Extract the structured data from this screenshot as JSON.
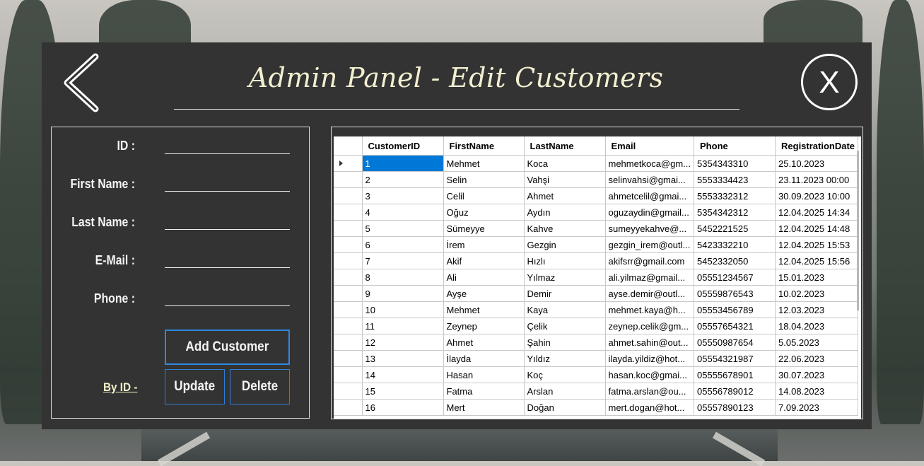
{
  "window": {
    "title": "Admin Panel - Edit Customers",
    "back_icon": "chevron-left-icon",
    "close_icon": "close-x-icon",
    "close_label": "X"
  },
  "form": {
    "id_label": "ID :",
    "first_name_label": "First Name :",
    "last_name_label": "Last Name :",
    "email_label": "E-Mail :",
    "phone_label": "Phone :",
    "id_value": "",
    "first_name_value": "",
    "last_name_value": "",
    "email_value": "",
    "phone_value": "",
    "add_label": "Add Customer",
    "update_label": "Update",
    "delete_label": "Delete",
    "byid_label": "By ID -"
  },
  "grid": {
    "columns": [
      "CustomerID",
      "FirstName",
      "LastName",
      "Email",
      "Phone",
      "RegistrationDate"
    ],
    "selected_row": 0,
    "rows": [
      [
        "1",
        "Mehmet",
        "Koca",
        "mehmetkoca@gm...",
        "5354343310",
        "25.10.2023"
      ],
      [
        "2",
        "Selin",
        "Vahşi",
        "selinvahsi@gmai...",
        "5553334423",
        "23.11.2023 00:00"
      ],
      [
        "3",
        "Celil",
        "Ahmet",
        "ahmetcelil@gmai...",
        "5553332312",
        "30.09.2023 10:00"
      ],
      [
        "4",
        "Oğuz",
        "Aydın",
        "oguzaydin@gmail...",
        "5354342312",
        "12.04.2025 14:34"
      ],
      [
        "5",
        "Sümeyye",
        "Kahve",
        "sumeyyekahve@...",
        "5452221525",
        "12.04.2025 14:48"
      ],
      [
        "6",
        "İrem",
        "Gezgin",
        "gezgin_irem@outl...",
        "5423332210",
        "12.04.2025 15:53"
      ],
      [
        "7",
        "Akif",
        "Hızlı",
        "akifsrr@gmail.com",
        "5452332050",
        "12.04.2025 15:56"
      ],
      [
        "8",
        "Ali",
        "Yılmaz",
        "ali.yilmaz@gmail...",
        "05551234567",
        "15.01.2023"
      ],
      [
        "9",
        "Ayşe",
        "Demir",
        "ayse.demir@outl...",
        "05559876543",
        "10.02.2023"
      ],
      [
        "10",
        "Mehmet",
        "Kaya",
        "mehmet.kaya@h...",
        "05553456789",
        "12.03.2023"
      ],
      [
        "11",
        "Zeynep",
        "Çelik",
        "zeynep.celik@gm...",
        "05557654321",
        "18.04.2023"
      ],
      [
        "12",
        "Ahmet",
        "Şahin",
        "ahmet.sahin@out...",
        "05550987654",
        "5.05.2023"
      ],
      [
        "13",
        "İlayda",
        "Yıldız",
        "ilayda.yildiz@hot...",
        "05554321987",
        "22.06.2023"
      ],
      [
        "14",
        "Hasan",
        "Koç",
        "hasan.koc@gmai...",
        "05555678901",
        "30.07.2023"
      ],
      [
        "15",
        "Fatma",
        "Arslan",
        "fatma.arslan@ou...",
        "05556789012",
        "14.08.2023"
      ],
      [
        "16",
        "Mert",
        "Doğan",
        "mert.dogan@hot...",
        "05557890123",
        "7.09.2023"
      ]
    ]
  },
  "colors": {
    "panel": "#333333",
    "title": "#f3efd0",
    "button_border": "#2f7fd6",
    "selection": "#0078d7"
  }
}
